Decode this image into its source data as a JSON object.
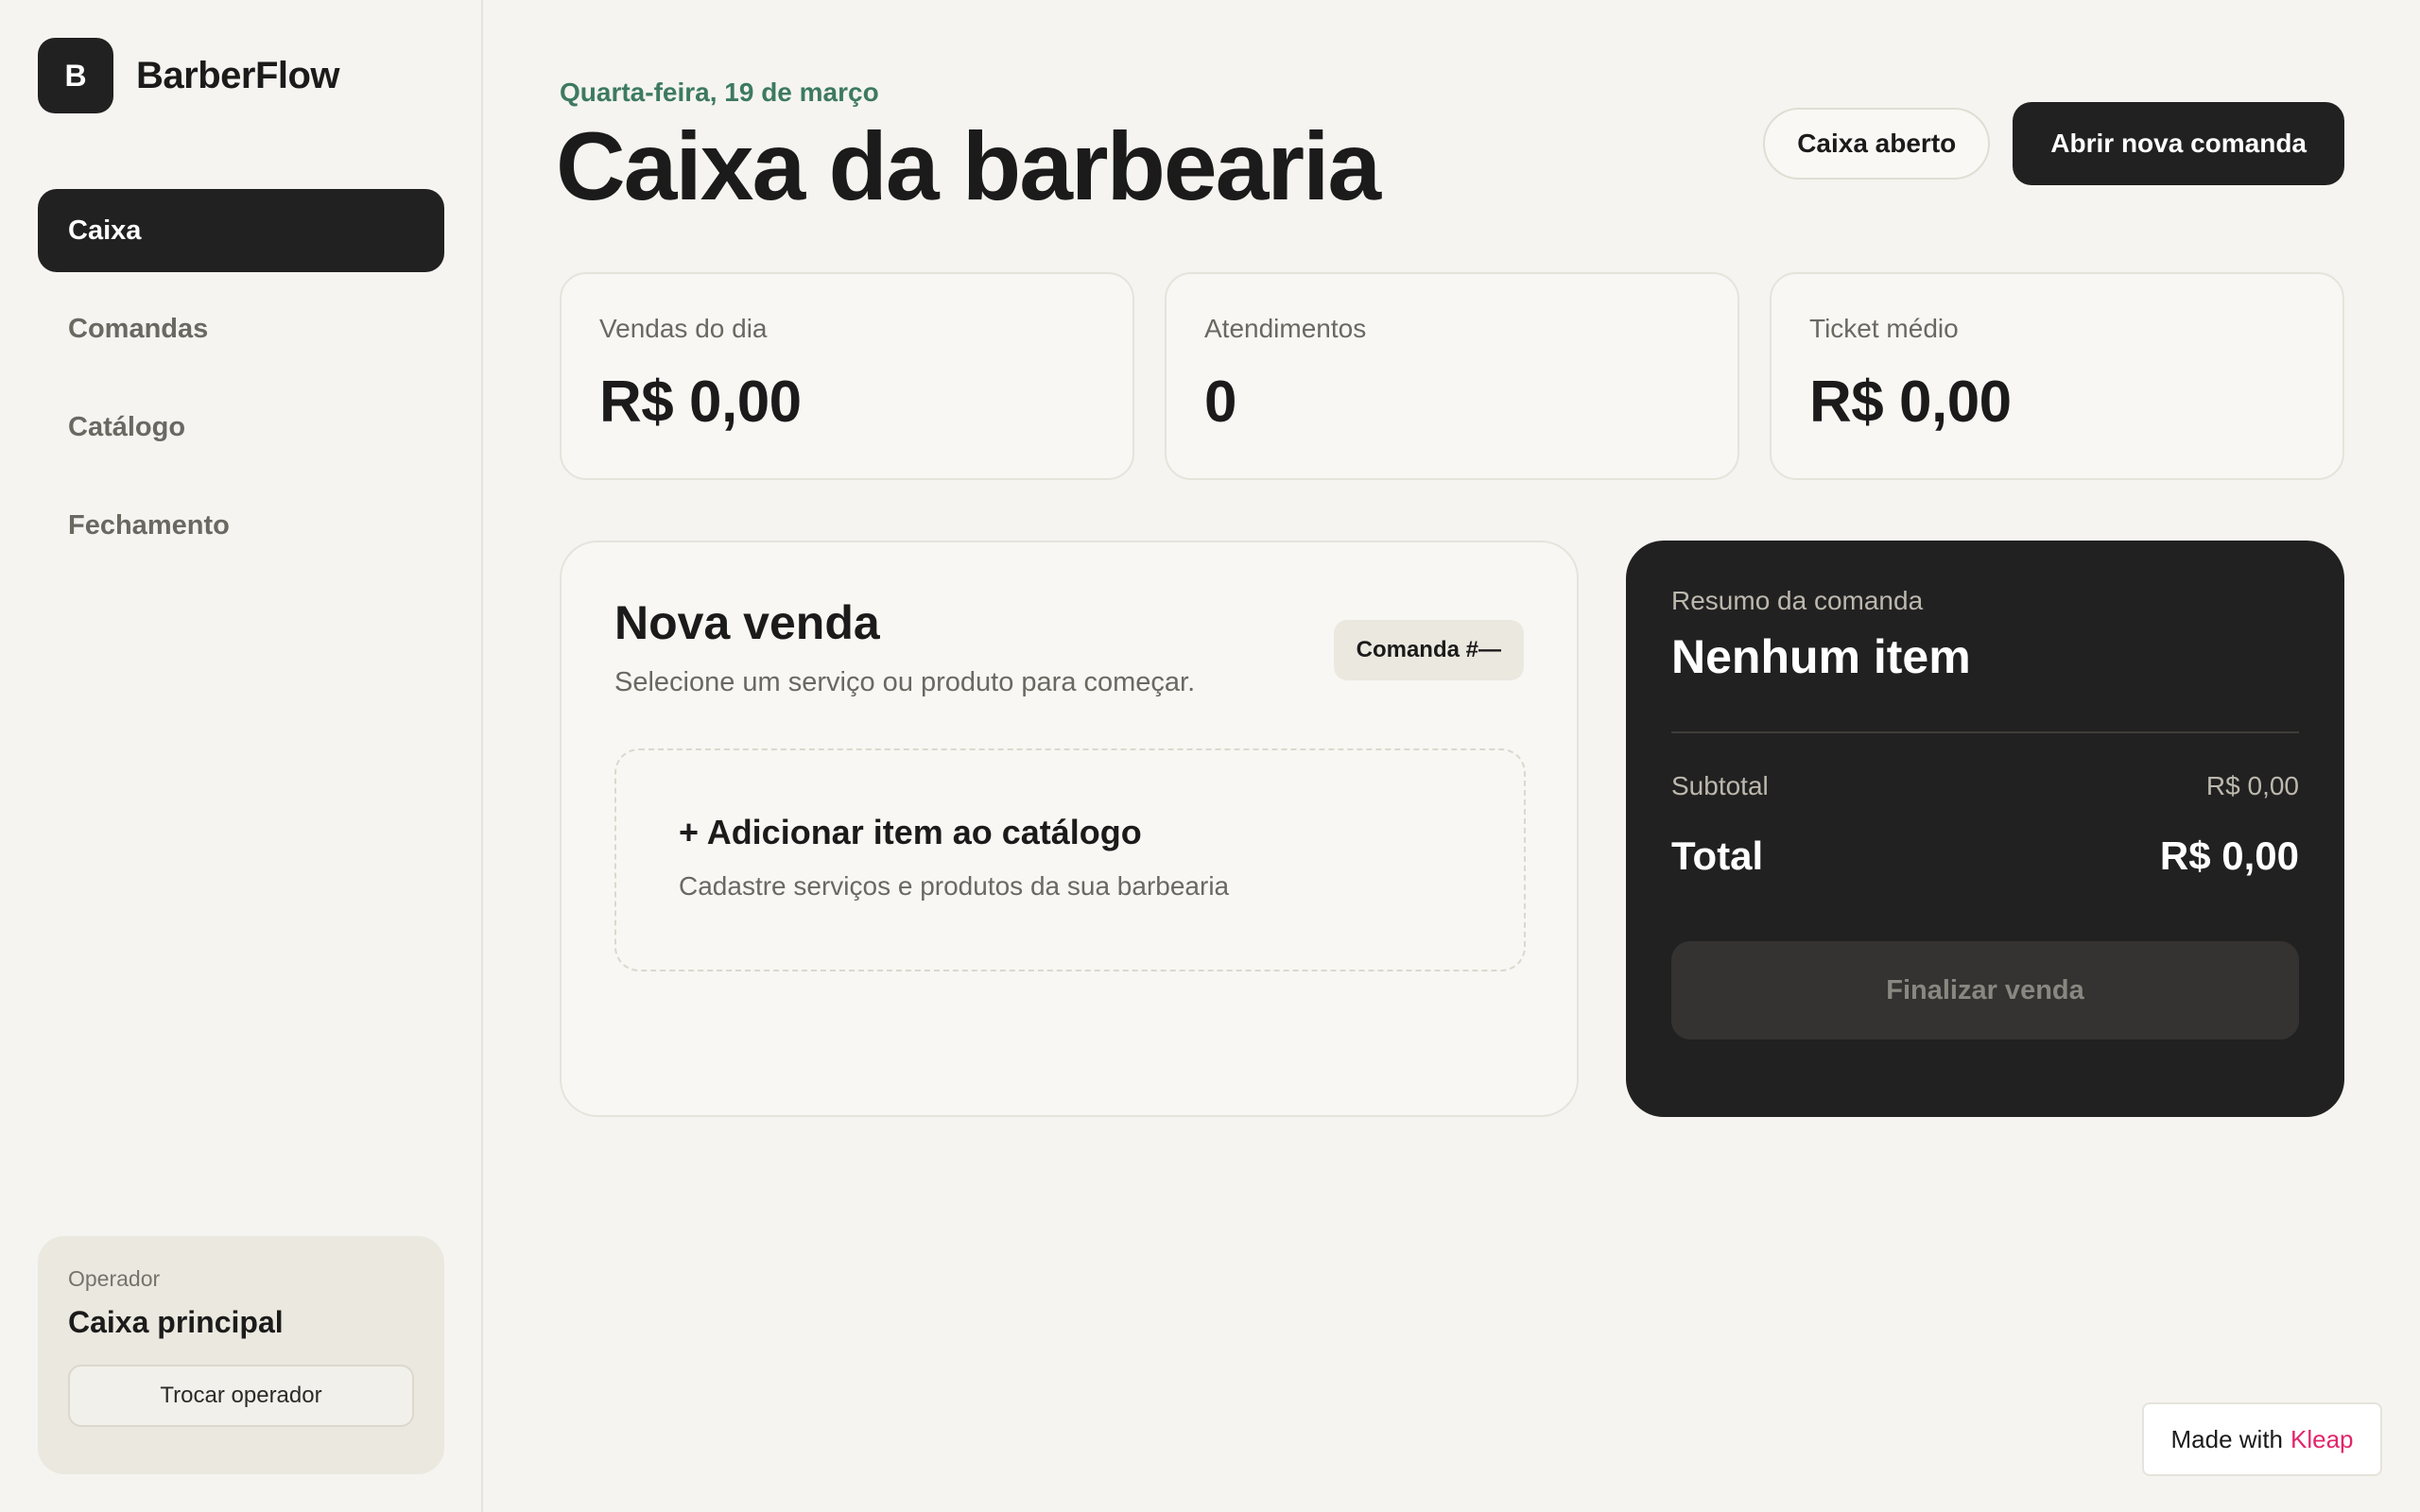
{
  "brand": {
    "logo_letter": "B",
    "name": "BarberFlow"
  },
  "sidebar": {
    "items": [
      {
        "label": "Caixa",
        "active": true
      },
      {
        "label": "Comandas",
        "active": false
      },
      {
        "label": "Catálogo",
        "active": false
      },
      {
        "label": "Fechamento",
        "active": false
      }
    ],
    "operator": {
      "label": "Operador",
      "name": "Caixa principal",
      "switch_label": "Trocar operador"
    }
  },
  "header": {
    "date": "Quarta-feira, 19 de março",
    "title": "Caixa da barbearia",
    "status_pill": "Caixa aberto",
    "primary_action": "Abrir nova comanda"
  },
  "stats": [
    {
      "label": "Vendas do dia",
      "value": "R$ 0,00"
    },
    {
      "label": "Atendimentos",
      "value": "0"
    },
    {
      "label": "Ticket médio",
      "value": "R$ 0,00"
    }
  ],
  "sale": {
    "title": "Nova venda",
    "subtitle": "Selecione um serviço ou produto para começar.",
    "order_chip": "Comanda #—",
    "add_title": "+ Adicionar item ao catálogo",
    "add_subtitle": "Cadastre serviços e produtos da sua barbearia"
  },
  "summary": {
    "label": "Resumo da comanda",
    "title": "Nenhum item",
    "subtotal_label": "Subtotal",
    "subtotal_value": "R$ 0,00",
    "total_label": "Total",
    "total_value": "R$ 0,00",
    "finish_label": "Finalizar venda"
  },
  "badge": {
    "prefix": "Made with",
    "brand": "Kleap"
  },
  "colors": {
    "background": "#f5f4f0",
    "dark": "#222121",
    "accent_green": "#3d7a60",
    "kleap_pink": "#e3256b"
  }
}
